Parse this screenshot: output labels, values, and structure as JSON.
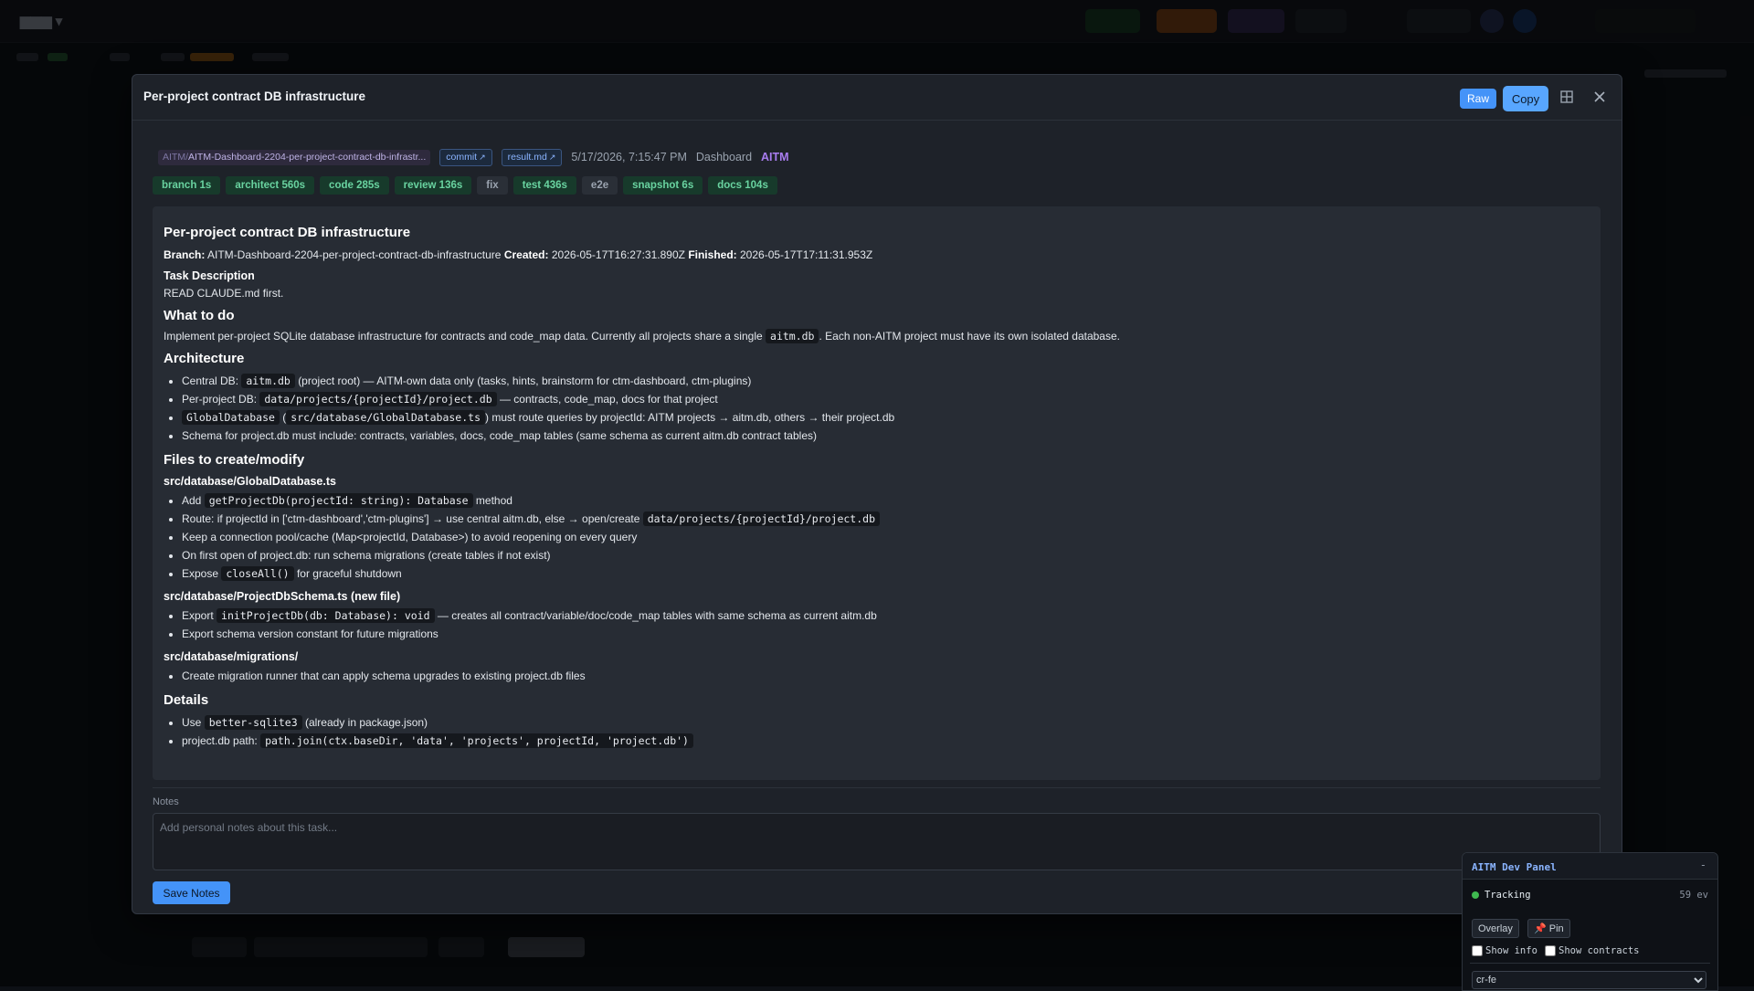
{
  "modal": {
    "title": "Per-project contract DB infrastructure",
    "raw_label": "Raw",
    "copy_label": "Copy"
  },
  "meta": {
    "branch_prefix": "AITM/",
    "branch_text": "AITM-Dashboard-2204-per-project-contract-db-infrastr...",
    "commit_label": "commit",
    "result_label": "result.md",
    "timestamp": "5/17/2026, 7:15:47 PM",
    "source": "Dashboard",
    "project": "AITM"
  },
  "stages": [
    {
      "label": "branch 1s",
      "done": true
    },
    {
      "label": "architect 560s",
      "done": true
    },
    {
      "label": "code 285s",
      "done": true
    },
    {
      "label": "review 136s",
      "done": true
    },
    {
      "label": "fix",
      "done": false
    },
    {
      "label": "test 436s",
      "done": true
    },
    {
      "label": "e2e",
      "done": false
    },
    {
      "label": "snapshot 6s",
      "done": true
    },
    {
      "label": "docs 104s",
      "done": true
    }
  ],
  "doc": {
    "title": "Per-project contract DB infrastructure",
    "branch_key": "Branch:",
    "branch_val": "AITM-Dashboard-2204-per-project-contract-db-infrastructure",
    "created_key": "Created:",
    "created_val": "2026-05-17T16:27:31.890Z",
    "finished_key": "Finished:",
    "finished_val": "2026-05-17T17:11:31.953Z",
    "task_heading": "Task Description",
    "task_text": "READ CLAUDE.md first.",
    "todo_heading": "What to do",
    "todo_a": "Implement per-project SQLite database infrastructure for contracts and code_map data. Currently all projects share a single",
    "todo_code": "aitm.db",
    "todo_b": ". Each non-AITM project must have its own isolated database.",
    "arch_heading": "Architecture",
    "arch": {
      "l1a": "Central DB:",
      "l1code": "aitm.db",
      "l1b": "(project root) — AITM-own data only (tasks, hints, brainstorm for ctm-dashboard, ctm-plugins)",
      "l2a": "Per-project DB:",
      "l2code": "data/projects/{projectId}/project.db",
      "l2b": "— contracts, code_map, docs for that project",
      "l3code1": "GlobalDatabase",
      "l3a": "(",
      "l3code2": "src/database/GlobalDatabase.ts",
      "l3b": ") must route queries by projectId: AITM projects → aitm.db, others → their project.db",
      "l4": "Schema for project.db must include: contracts, variables, docs, code_map tables (same schema as current aitm.db contract tables)"
    },
    "files_heading": "Files to create/modify",
    "gdb": {
      "heading": "src/database/GlobalDatabase.ts",
      "l1a": "Add",
      "l1code": "getProjectDb(projectId: string): Database",
      "l1b": "method",
      "l2a": "Route: if projectId in ['ctm-dashboard','ctm-plugins'] → use central aitm.db, else → open/create",
      "l2code": "data/projects/{projectId}/project.db",
      "l3": "Keep a connection pool/cache (Map<projectId, Database>) to avoid reopening on every query",
      "l4": "On first open of project.db: run schema migrations (create tables if not exist)",
      "l5a": "Expose",
      "l5code": "closeAll()",
      "l5b": "for graceful shutdown"
    },
    "schema": {
      "heading": "src/database/ProjectDbSchema.ts (new file)",
      "l1a": "Export",
      "l1code": "initProjectDb(db: Database): void",
      "l1b": "— creates all contract/variable/doc/code_map tables with same schema as current aitm.db",
      "l2": "Export schema version constant for future migrations"
    },
    "mig": {
      "heading": "src/database/migrations/",
      "l1": "Create migration runner that can apply schema upgrades to existing project.db files"
    },
    "details_heading": "Details",
    "details": {
      "l1a": "Use",
      "l1code": "better-sqlite3",
      "l1b": "(already in package.json)",
      "l2a": "project.db path:",
      "l2code": "path.join(ctx.baseDir, 'data', 'projects', projectId, 'project.db')"
    }
  },
  "notes": {
    "label": "Notes",
    "placeholder": "Add personal notes about this task...",
    "value": "",
    "save_label": "Save Notes"
  },
  "dev_panel": {
    "title": "AITM Dev Panel",
    "minimize": "-",
    "status": "Tracking",
    "events": "59 ev",
    "overlay_label": "Overlay",
    "pin_label": "📌 Pin",
    "show_info": "Show info",
    "show_contracts": "Show contracts",
    "select_value": "cr-fe",
    "status_color": "#3fb950"
  },
  "colors": {
    "accent": "#4493f8",
    "stage_done": "#69d3a0",
    "project": "#a97df0"
  },
  "icons": [
    "external-link-icon",
    "layout-grid-icon",
    "close-icon",
    "pin-icon"
  ]
}
